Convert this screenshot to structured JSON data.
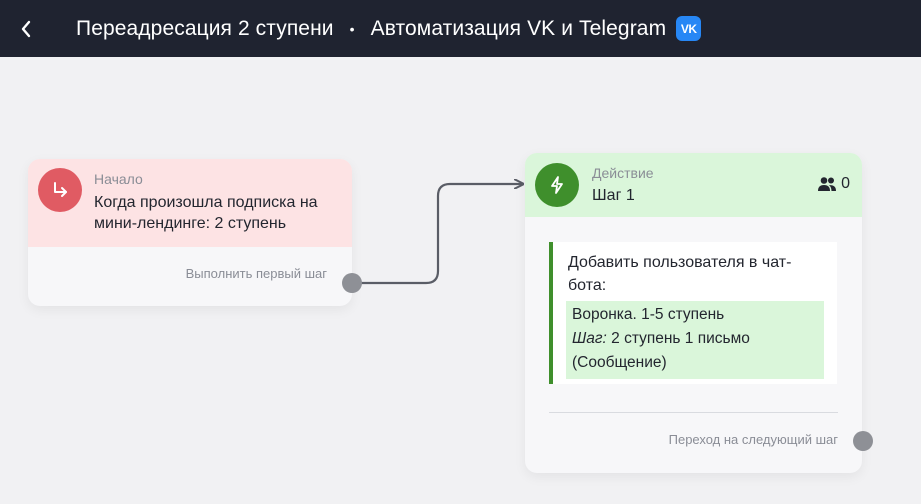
{
  "header": {
    "title": "Переадресация 2 ступени",
    "separator": "•",
    "subtitle": "Автоматизация VK и Telegram",
    "badge": "VK",
    "back_icon": "chevron-left-icon"
  },
  "start_node": {
    "label": "Начало",
    "description": "Когда произошла подписка на мини-лендинге: 2 ступень",
    "action_label": "Выполнить первый шаг",
    "icon": "arrow-turn-icon",
    "color": "#e05b63"
  },
  "action_node": {
    "label": "Действие",
    "title": "Шаг 1",
    "users_count": "0",
    "icon": "lightning-icon",
    "color": "#3f8f2c",
    "task": {
      "text": "Добавить пользователя в чат-бота:",
      "funnel": "Воронка. 1-5 ступень",
      "step_prefix": "Шаг:",
      "step_value": "2 ступень 1 письмо",
      "step_note": "(Сообщение)"
    },
    "next_label": "Переход на следующий шаг"
  }
}
